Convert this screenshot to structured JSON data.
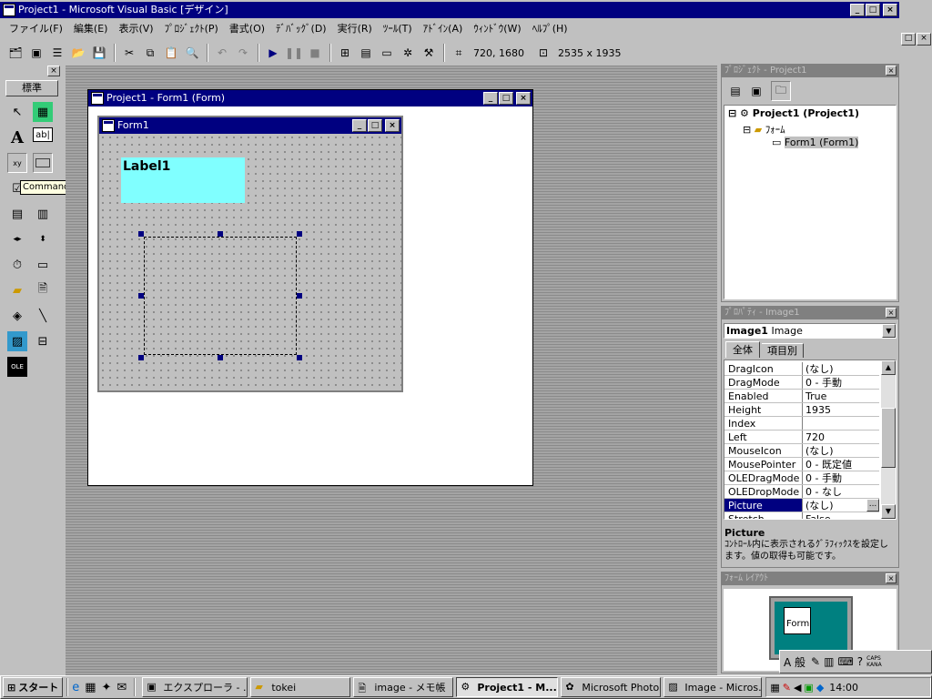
{
  "app": {
    "title": "Project1 - Microsoft Visual Basic [デザイン]"
  },
  "menu": [
    {
      "label": "ファイル(F)"
    },
    {
      "label": "編集(E)"
    },
    {
      "label": "表示(V)"
    },
    {
      "label": "ﾌﾟﾛｼﾞｪｸﾄ(P)"
    },
    {
      "label": "書式(O)"
    },
    {
      "label": "ﾃﾞﾊﾞｯｸﾞ(D)"
    },
    {
      "label": "実行(R)"
    },
    {
      "label": "ﾂｰﾙ(T)"
    },
    {
      "label": "ｱﾄﾞｲﾝ(A)"
    },
    {
      "label": "ｳｨﾝﾄﾞｳ(W)"
    },
    {
      "label": "ﾍﾙﾌﾟ(H)"
    }
  ],
  "toolbar": {
    "position": "720, 1680",
    "size": "2535 x 1935"
  },
  "toolbox": {
    "header": "標準",
    "tooltip": "CommandButton"
  },
  "designer": {
    "title": "Project1 - Form1 (Form)",
    "form_title": "Form1",
    "label_caption": "Label1"
  },
  "project": {
    "title": "ﾌﾟﾛｼﾞｪｸﾄ - Project1",
    "root": "Project1 (Project1)",
    "folder": "ﾌｫｰﾑ",
    "form": "Form1 (Form1)"
  },
  "properties": {
    "title": "ﾌﾟﾛﾊﾟﾃｨ - Image1",
    "object_name": "Image1",
    "object_type": "Image",
    "tab_all": "全体",
    "tab_category": "項目別",
    "rows": [
      {
        "name": "DragIcon",
        "value": "(なし)"
      },
      {
        "name": "DragMode",
        "value": "0 - 手動"
      },
      {
        "name": "Enabled",
        "value": "True"
      },
      {
        "name": "Height",
        "value": "1935"
      },
      {
        "name": "Index",
        "value": ""
      },
      {
        "name": "Left",
        "value": "720"
      },
      {
        "name": "MouseIcon",
        "value": "(なし)"
      },
      {
        "name": "MousePointer",
        "value": "0 - 既定値"
      },
      {
        "name": "OLEDragMode",
        "value": "0 - 手動"
      },
      {
        "name": "OLEDropMode",
        "value": "0 - なし"
      },
      {
        "name": "Picture",
        "value": "(なし)"
      },
      {
        "name": "Stretch",
        "value": "False"
      }
    ],
    "selected": "Picture",
    "desc_title": "Picture",
    "desc_text": "ｺﾝﾄﾛｰﾙ内に表示されるｸﾞﾗﾌｨｯｸｽを設定します。値の取得も可能です。"
  },
  "layout": {
    "title": "ﾌｫｰﾑ ﾚｲｱｳﾄ",
    "form_label": "Form"
  },
  "ime": {
    "mode": "A 般",
    "caps": "CAPS",
    "kana": "KANA"
  },
  "taskbar": {
    "start": "スタート",
    "tasks": [
      {
        "label": "エクスプローラ - ..."
      },
      {
        "label": "tokei"
      },
      {
        "label": "image - メモ帳"
      },
      {
        "label": "Project1 - M..."
      },
      {
        "label": "Microsoft Photo..."
      },
      {
        "label": "Image - Micros..."
      }
    ],
    "clock": "14:00"
  },
  "colors": {
    "title_active": "#000080",
    "title_inactive": "#808080",
    "label_bg": "#80ffff",
    "layout_screen": "#008080"
  }
}
